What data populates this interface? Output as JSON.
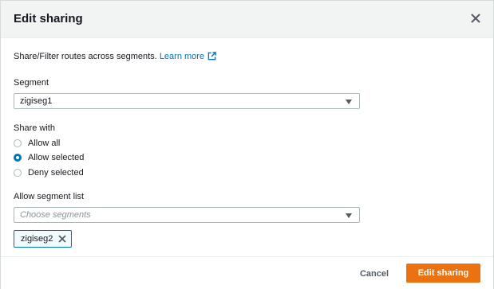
{
  "modal": {
    "title": "Edit sharing",
    "description": "Share/Filter routes across segments.",
    "learn_more": "Learn more"
  },
  "segment": {
    "label": "Segment",
    "value": "zigiseg1"
  },
  "share_with": {
    "label": "Share with",
    "options": [
      {
        "label": "Allow all",
        "checked": false
      },
      {
        "label": "Allow selected",
        "checked": true
      },
      {
        "label": "Deny selected",
        "checked": false
      }
    ]
  },
  "segment_list": {
    "label": "Allow segment list",
    "placeholder": "Choose segments",
    "tokens": [
      "zigiseg2"
    ]
  },
  "footer": {
    "cancel_label": "Cancel",
    "submit_label": "Edit sharing"
  },
  "colors": {
    "accent": "#ec7211",
    "link": "#0073bb"
  }
}
